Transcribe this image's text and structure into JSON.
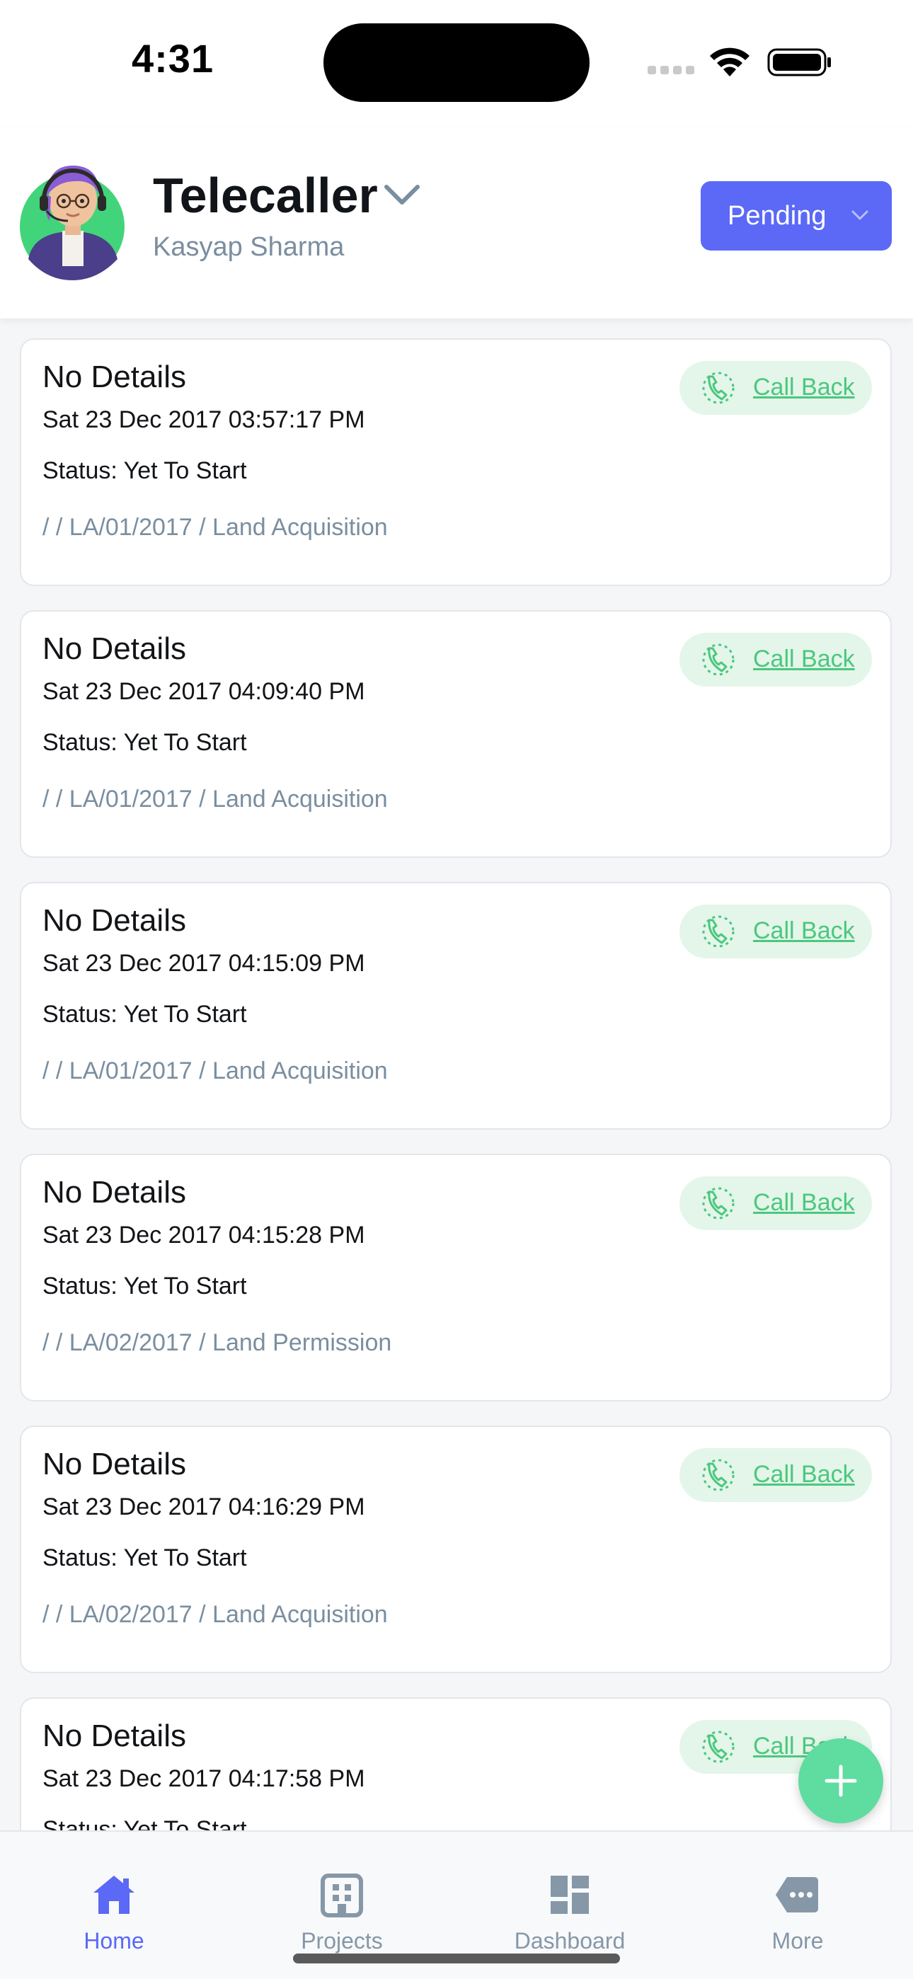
{
  "status_bar": {
    "time": "4:31"
  },
  "header": {
    "role_title": "Telecaller",
    "user_name": "Kasyap Sharma",
    "filter_dropdown": {
      "selected": "Pending"
    }
  },
  "cards": [
    {
      "title": "No Details",
      "date": "Sat 23 Dec 2017 03:57:17 PM",
      "status": "Status: Yet To Start",
      "path": "/  / LA/01/2017 / Land Acquisition",
      "action_label": "Call Back"
    },
    {
      "title": "No Details",
      "date": "Sat 23 Dec 2017 04:09:40 PM",
      "status": "Status: Yet To Start",
      "path": "/  / LA/01/2017 / Land Acquisition",
      "action_label": "Call Back"
    },
    {
      "title": "No Details",
      "date": "Sat 23 Dec 2017 04:15:09 PM",
      "status": "Status: Yet To Start",
      "path": "/  / LA/01/2017 / Land Acquisition",
      "action_label": "Call Back"
    },
    {
      "title": "No Details",
      "date": "Sat 23 Dec 2017 04:15:28 PM",
      "status": "Status: Yet To Start",
      "path": "/  / LA/02/2017 / Land Permission",
      "action_label": "Call Back"
    },
    {
      "title": "No Details",
      "date": "Sat 23 Dec 2017 04:16:29 PM",
      "status": "Status: Yet To Start",
      "path": "/  / LA/02/2017 / Land Acquisition",
      "action_label": "Call Back"
    },
    {
      "title": "No Details",
      "date": "Sat 23 Dec 2017 04:17:58 PM",
      "status": "Status: Yet To Start",
      "path": "",
      "action_label": "Call Back"
    }
  ],
  "tab_bar": {
    "tabs": [
      {
        "label": "Home",
        "icon": "home-icon",
        "active": true
      },
      {
        "label": "Projects",
        "icon": "building-icon",
        "active": false
      },
      {
        "label": "Dashboard",
        "icon": "dashboard-icon",
        "active": false
      },
      {
        "label": "More",
        "icon": "more-icon",
        "active": false
      }
    ]
  },
  "colors": {
    "accent": "#5b69f6",
    "callback_green": "#4cc77e",
    "fab_green": "#5fdca0",
    "muted_text": "#7a8ea0"
  }
}
